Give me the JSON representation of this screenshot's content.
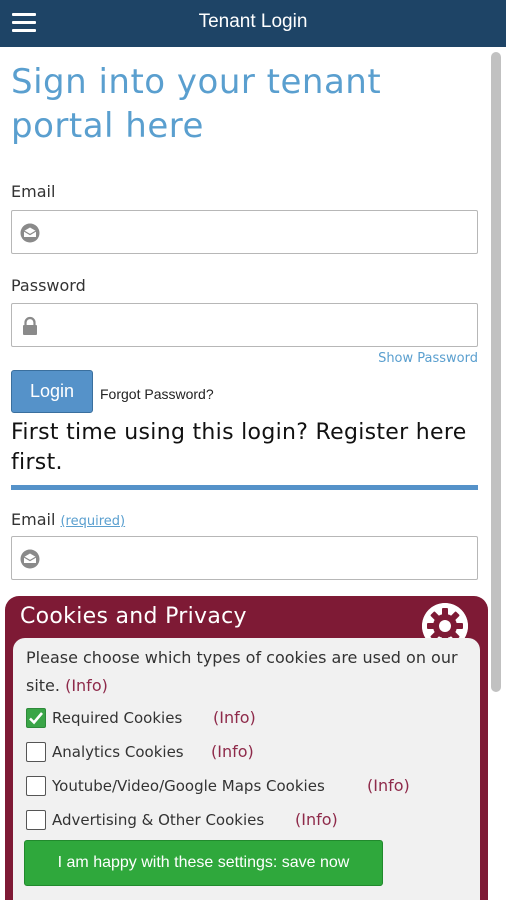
{
  "header": {
    "title": "Tenant Login",
    "menu_icon": "hamburger-icon"
  },
  "login": {
    "heading": "Sign into your tenant portal here",
    "email_label": "Email",
    "password_label": "Password",
    "show_password": "Show Password",
    "login_button": "Login",
    "forgot_password": "Forgot Password?"
  },
  "register": {
    "text": "First time using this login? Register here first.",
    "email_label": "Email",
    "required_link": "(required)"
  },
  "cookies": {
    "title": "Cookies and Privacy",
    "description": "Please choose which types of cookies are used on our site.",
    "info_label": "(Info)",
    "options": [
      {
        "label": "Required Cookies",
        "checked": true
      },
      {
        "label": "Analytics Cookies",
        "checked": false
      },
      {
        "label": "Youtube/Video/Google Maps Cookies",
        "checked": false
      },
      {
        "label": "Advertising & Other Cookies",
        "checked": false
      }
    ],
    "save_button": "I am happy with these settings: save now"
  },
  "colors": {
    "header_bg": "#1e4466",
    "accent_blue": "#5592c9",
    "cookie_panel": "#7e1a35",
    "save_green": "#2fa83c"
  }
}
